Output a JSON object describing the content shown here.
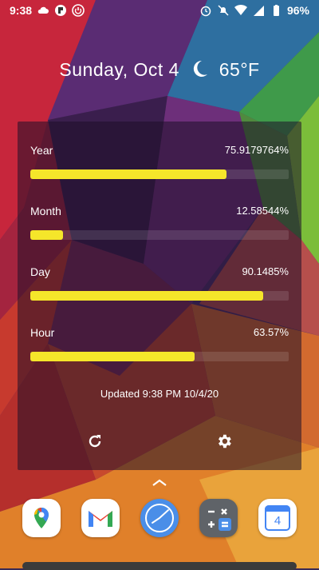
{
  "status_bar": {
    "time": "9:38",
    "battery": "96%",
    "left_icons": [
      "cloud-icon",
      "notification-app-icon",
      "power-app-icon"
    ],
    "right_icons": [
      "alarm-icon",
      "do-not-disturb-off-icon",
      "wifi-icon",
      "cell-signal-icon",
      "battery-icon"
    ]
  },
  "header": {
    "date": "Sunday, Oct 4",
    "weather_icon": "crescent-moon-icon",
    "temperature": "65°F"
  },
  "widget": {
    "rows": [
      {
        "label": "Year",
        "value": "75.9179764%",
        "progress": 0.759
      },
      {
        "label": "Month",
        "value": "12.58544%",
        "progress": 0.126
      },
      {
        "label": "Day",
        "value": "90.1485%",
        "progress": 0.901
      },
      {
        "label": "Hour",
        "value": "63.57%",
        "progress": 0.636
      }
    ],
    "updated": "Updated 9:38 PM 10/4/20",
    "refresh_icon": "refresh-icon",
    "settings_icon": "gear-icon"
  },
  "dock": {
    "apps": [
      {
        "name": "maps-app-icon"
      },
      {
        "name": "gmail-app-icon"
      },
      {
        "name": "clock-app-icon"
      },
      {
        "name": "calculator-app-icon"
      },
      {
        "name": "calendar-app-icon",
        "label": "4"
      }
    ]
  },
  "colors": {
    "progress_fill": "#f5e62a",
    "widget_bg": "rgba(30,15,40,0.55)"
  }
}
